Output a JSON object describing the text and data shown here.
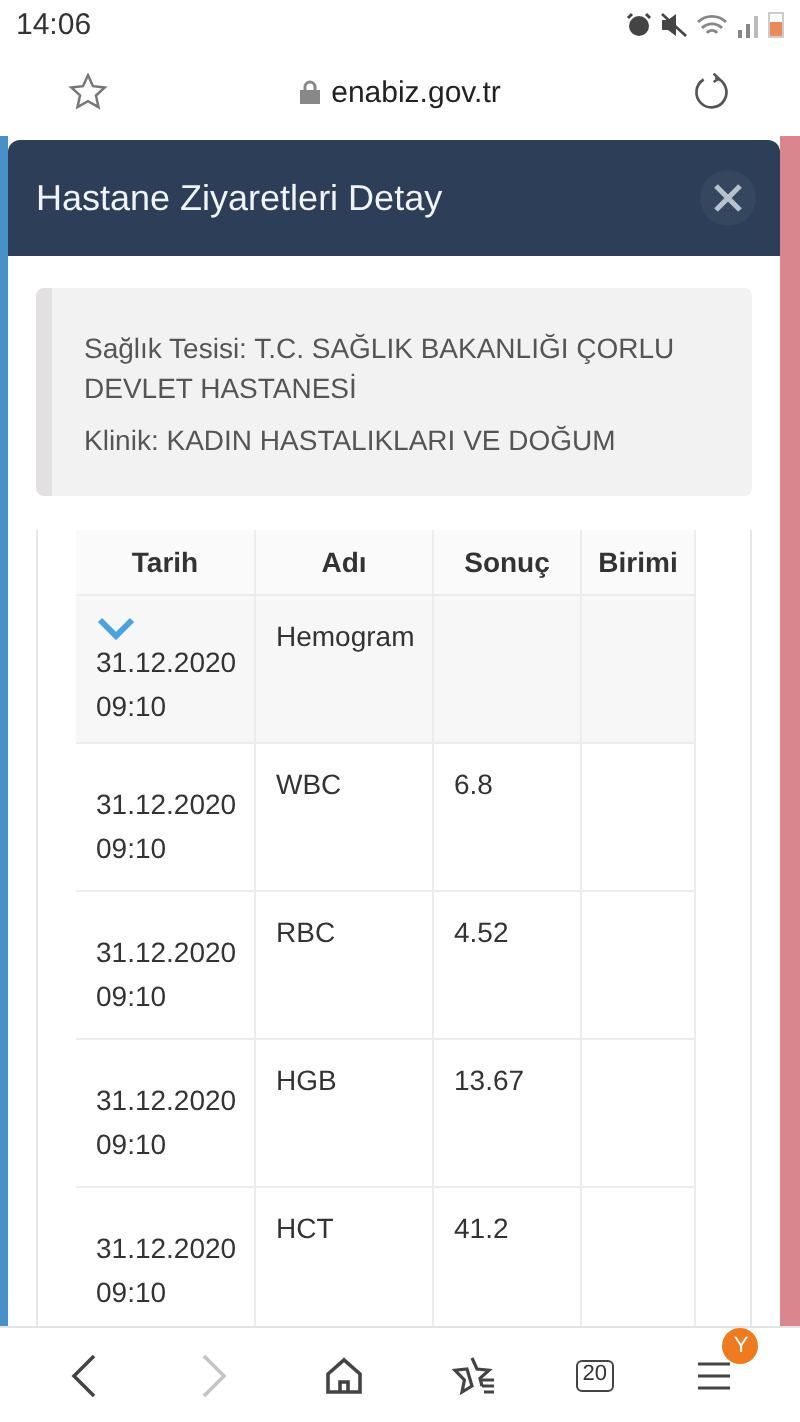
{
  "status_bar": {
    "time": "14:06"
  },
  "browser": {
    "url": "enabiz.gov.tr",
    "forward_disabled": true,
    "tab_count": "20",
    "menu_badge": "Y"
  },
  "modal": {
    "title": "Hastane Ziyaretleri Detay",
    "info": [
      "Sağlık Tesisi: T.C. SAĞLIK BAKANLIĞI ÇORLU DEVLET HASTANESİ",
      "Klinik: KADIN HASTALIKLARI VE DOĞUM"
    ],
    "table": {
      "columns": [
        "Tarih",
        "Adı",
        "Sonuç",
        "Birimi"
      ],
      "rows": [
        {
          "kind": "group",
          "expanded": true,
          "datetime": "31.12.2020 09:10",
          "name": "Hemogram"
        },
        {
          "kind": "item",
          "datetime": "31.12.2020 09:10",
          "name": "WBC",
          "result": "6.8"
        },
        {
          "kind": "item",
          "datetime": "31.12.2020 09:10",
          "name": "RBC",
          "result": "4.52"
        },
        {
          "kind": "item",
          "datetime": "31.12.2020 09:10",
          "name": "HGB",
          "result": "13.67"
        },
        {
          "kind": "item",
          "datetime": "31.12.2020 09:10",
          "name": "HCT",
          "result": "41.2"
        }
      ]
    }
  }
}
